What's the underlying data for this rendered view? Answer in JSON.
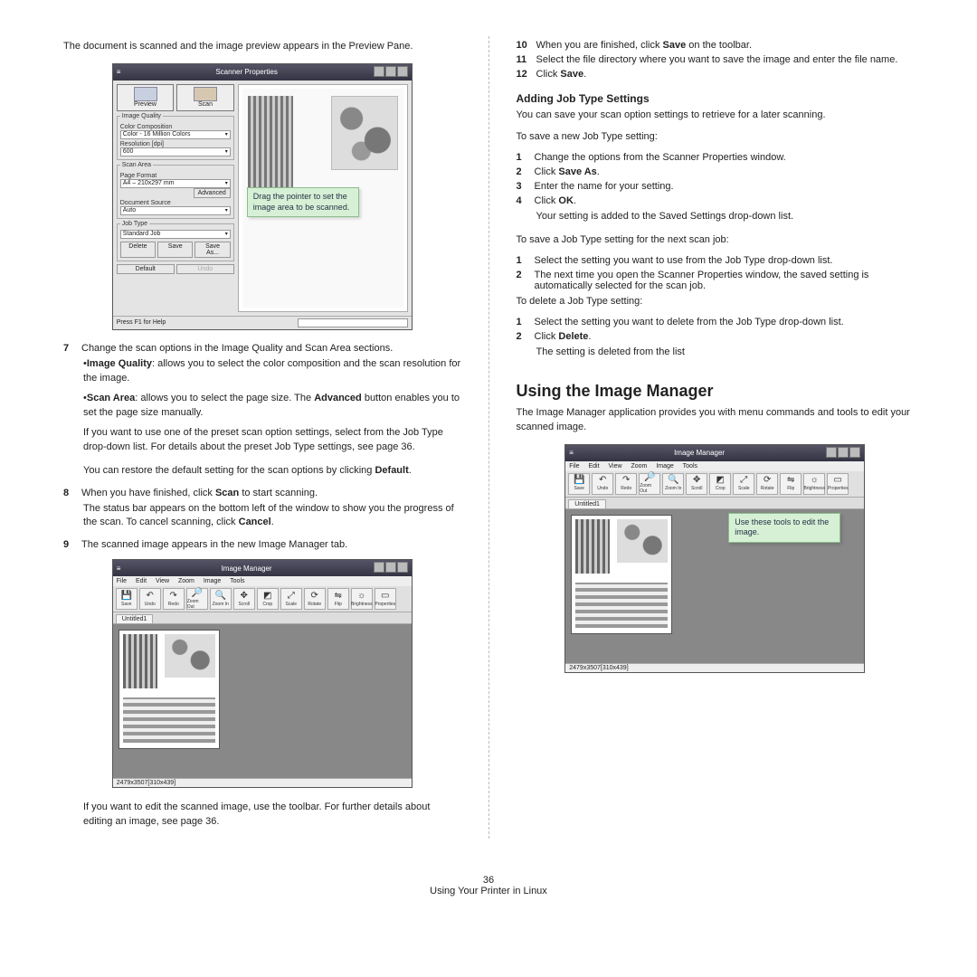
{
  "intro": "The document is scanned and the image preview appears in the Preview Pane.",
  "tip_scan": "Drag the pointer to set the image area to be scanned.",
  "scanner": {
    "title": "Scanner Properties",
    "preview_btn": "Preview",
    "scan_btn": "Scan",
    "grp_img": "Image Quality",
    "color_comp": "Color Composition",
    "color_val": "Color - 16 Million Colors",
    "res_lbl": "Resolution [dpi]",
    "res_val": "600",
    "grp_scan": "Scan Area",
    "page_fmt": "Page Format",
    "page_val": "A4 – 210x297 mm",
    "advanced": "Advanced",
    "doc_src": "Document Source",
    "doc_val": "Auto",
    "grp_job": "Job Type",
    "job_val": "Standard Job",
    "del": "Delete",
    "save": "Save",
    "saveas": "Save As...",
    "default": "Default",
    "undo": "Undo",
    "status": "Press F1 for Help"
  },
  "step7": "Change the scan options in the Image Quality and Scan Area sections.",
  "bullet_iq_a": "Image Quality",
  "bullet_iq_b": ": allows you to select the color composition and the scan resolution for the image.",
  "bullet_sa_a": "Scan Area",
  "bullet_sa_b": ": allows you to select the page size. The ",
  "bullet_sa_c": "Advanced",
  "bullet_sa_d": " button enables you to set the page size manually.",
  "para_preset": "If you want to use one of the preset scan option settings, select from the Job Type drop-down list. For details about the preset Job Type settings, see page 36.",
  "para_default_a": "You can restore the default setting for the scan options by clicking ",
  "para_default_b": "Default",
  "period": ".",
  "step8_a": "When you have finished, click ",
  "step8_b": "Scan",
  "step8_c": " to start scanning.",
  "para_status_a": "The status bar appears on the bottom left of the window to show you the progress of the scan. To cancel scanning, click ",
  "para_status_b": "Cancel",
  "step9": "The scanned image appears in the new Image Manager tab.",
  "para_edit": "If you want to edit the scanned image, use the toolbar. For further details about editing an image, see page 36.",
  "imwin": {
    "title": "Image Manager",
    "menu_file": "File",
    "menu_edit": "Edit",
    "menu_view": "View",
    "menu_zoom": "Zoom",
    "menu_image": "Image",
    "menu_tools": "Tools",
    "tab": "Untitled1",
    "status": "2479x3507[310x439]",
    "tb_save": "Save",
    "tb_undo": "Undo",
    "tb_redo": "Redo",
    "tb_zoomout": "Zoom Out",
    "tb_zoomin": "Zoom In",
    "tb_scroll": "Scroll",
    "tb_crop": "Crop",
    "tb_scale": "Scale",
    "tb_rotate": "Rotate",
    "tb_flip": "Flip",
    "tb_bright": "Brightness",
    "tb_props": "Properties"
  },
  "tip_im": "Use these tools to edit the image.",
  "r10_a": "When you are finished, click ",
  "r10_b": "Save",
  "r10_c": " on the toolbar.",
  "r11": "Select the file directory where you want to save the image and enter the file name.",
  "r12_a": "Click ",
  "r12_b": "Save",
  "sub_add": "Adding Job Type Settings",
  "add_intro": "You can save your scan option settings to retrieve for a later scanning.",
  "add_save_new": "To save a new Job Type setting:",
  "a1": "Change the options from the Scanner Properties window.",
  "a2a": "Click ",
  "a2b": "Save As",
  "a3": "Enter the name for your setting.",
  "a4a": "Click ",
  "a4b": "OK",
  "a_after": "Your setting is added to the Saved Settings drop-down list.",
  "add_save_next": "To save a Job Type setting for the next scan job:",
  "b1": "Select the setting you want to use from the Job Type drop-down list.",
  "b2": "The next time you open the Scanner Properties window, the saved setting is automatically selected for the scan job.",
  "add_delete": "To delete a Job Type setting:",
  "c1": "Select the setting you want to delete from the Job Type drop-down list.",
  "c2a": "Click ",
  "c2b": "Delete",
  "c_after": "The setting is deleted from the list",
  "h2_im": "Using the Image Manager",
  "im_intro": "The Image Manager application provides you with menu commands and tools to edit your scanned image.",
  "page_no": "36",
  "footer": "Using Your Printer in Linux"
}
